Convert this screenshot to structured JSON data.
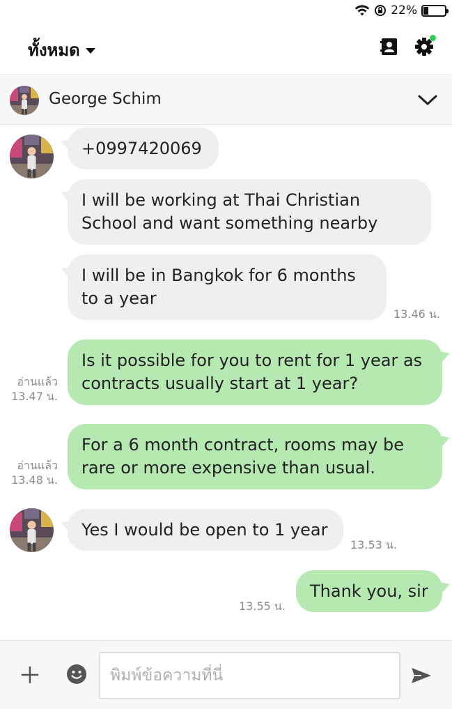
{
  "status_bar": {
    "battery_text": "22%",
    "battery_level": 0.22
  },
  "header": {
    "filter_label": "ทั้งหมด",
    "icons": {
      "contacts": "contact-book-icon",
      "settings": "gear-icon"
    }
  },
  "chat": {
    "contact_name": "George Schim"
  },
  "messages": [
    {
      "side": "in",
      "text": "+0997420069",
      "time": ""
    },
    {
      "side": "in",
      "text": "I will be working at Thai Christian School and want something nearby",
      "time": ""
    },
    {
      "side": "in",
      "text": "I will be in Bangkok for 6 months to a year",
      "time": "13.46 น."
    },
    {
      "side": "out",
      "text": "Is it possible for you to rent for 1 year as contracts usually start at 1 year?",
      "read": "อ่านแล้ว",
      "time": "13.47 น."
    },
    {
      "side": "out",
      "text": "For a 6 month contract, rooms may be rare or more expensive than usual.",
      "read": "อ่านแล้ว",
      "time": "13.48 น."
    },
    {
      "side": "in",
      "text": "Yes I would be open to 1 year",
      "time": "13.53 น."
    },
    {
      "side": "out",
      "text": "Thank you, sir",
      "read": "",
      "time": "13.55 น."
    }
  ],
  "composer": {
    "placeholder": "พิมพ์ข้อความที่นี่",
    "icons": {
      "plus": "plus-icon",
      "emoji": "emoji-icon",
      "send": "send-icon"
    }
  },
  "colors": {
    "incoming_bubble": "#eeeff1",
    "outgoing_bubble": "#b6e8b2",
    "online_dot": "#2ecc52"
  }
}
